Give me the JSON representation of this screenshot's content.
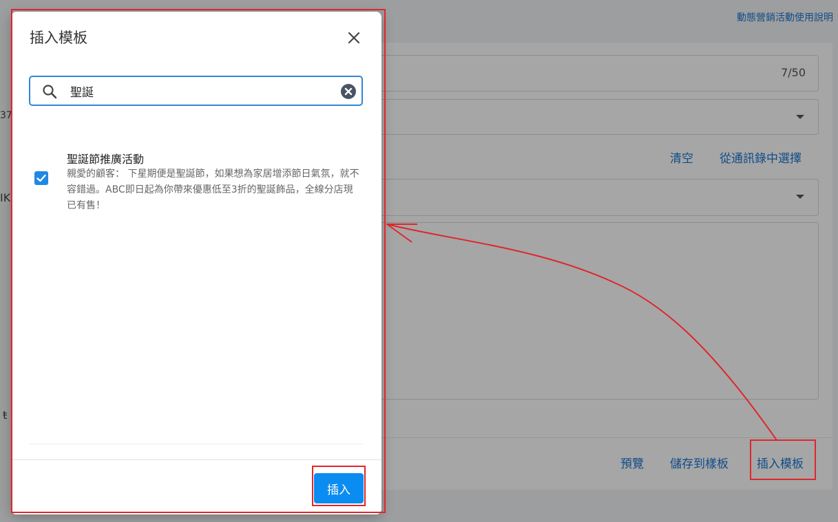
{
  "background": {
    "help_link": "動態營銷活動使用說明",
    "counter": "7/50",
    "clear_label": "清空",
    "from_contacts_label": "從通訊錄中選擇",
    "preview_label": "預覽",
    "save_template_label": "儲存到樣板",
    "insert_template_label": "插入模板",
    "left_stubs": [
      "37",
      "IK",
      "ŧ"
    ]
  },
  "modal": {
    "title": "插入模板",
    "search": {
      "value": "聖誕",
      "placeholder": ""
    },
    "items": [
      {
        "title": "聖誕節推廣活動",
        "body": "親愛的顧客： 下星期便是聖誕節，如果想為家居增添節日氣氛，就不容錯過。ABC即日起為你帶來優惠低至3折的聖誕飾品，全線分店現已有售！",
        "checked": true
      }
    ],
    "insert_button": "插入"
  },
  "colors": {
    "accent": "#1976d2",
    "primary_button": "#0a8cf0",
    "annotation": "#e0252b"
  }
}
